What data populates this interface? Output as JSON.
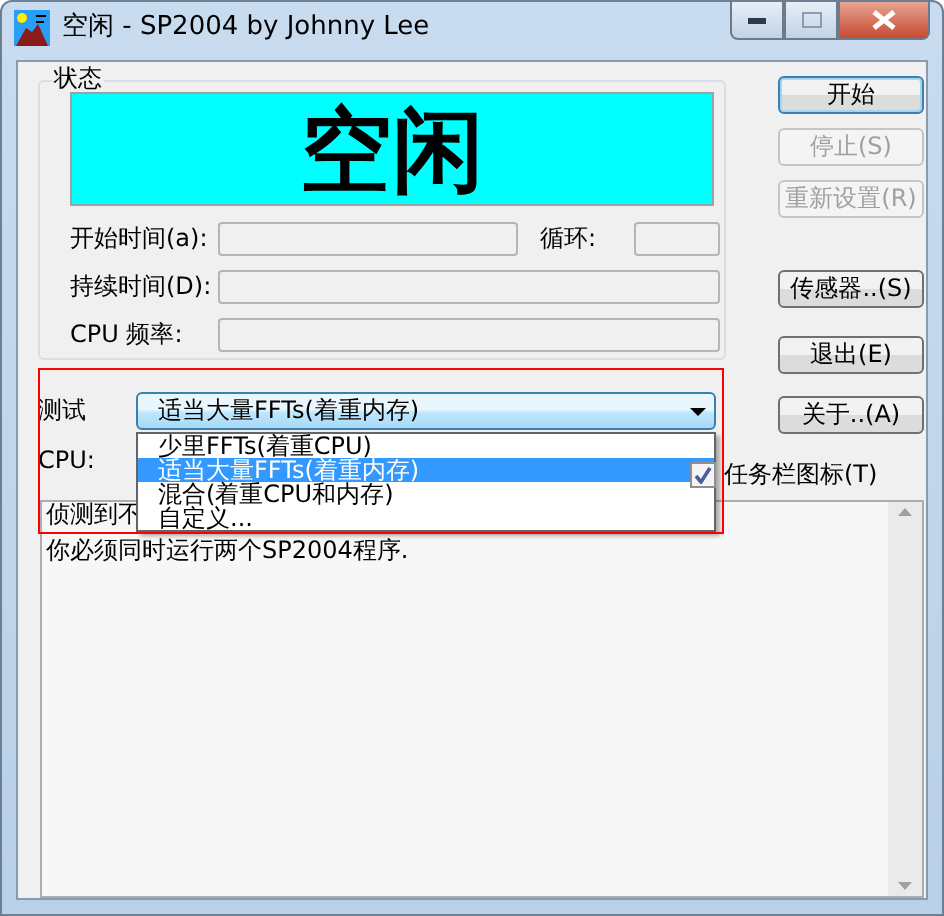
{
  "window": {
    "title": "空闲 - SP2004 by Johnny Lee"
  },
  "status": {
    "label": "状态",
    "display": "空闲",
    "start_time_label": "开始时间(a):",
    "loop_label": "循环:",
    "duration_label": "持续时间(D):",
    "cpu_freq_label": "CPU 频率:"
  },
  "buttons": [
    {
      "label": "开始",
      "disabled": false,
      "default": true
    },
    {
      "label": "停止(S)",
      "disabled": true,
      "default": false
    },
    {
      "label": "重新设置(R)",
      "disabled": true,
      "default": false
    },
    {
      "label": "传感器..(S)",
      "disabled": false,
      "default": false
    },
    {
      "label": "退出(E)",
      "disabled": false,
      "default": false
    },
    {
      "label": "关于..(A)",
      "disabled": false,
      "default": false
    }
  ],
  "test": {
    "label": "测试",
    "value": "适当大量FFTs(着重内存)",
    "expanded": true,
    "options": [
      {
        "label": "少里FFTs(着重CPU)",
        "selected": false
      },
      {
        "label": "适当大量FFTs(着重内存)",
        "selected": true
      },
      {
        "label": "混合(着重CPU和内存)",
        "selected": false
      },
      {
        "label": "自定义...",
        "selected": false
      }
    ]
  },
  "cpu_label": "CPU:",
  "taskbar_icon": {
    "label": "任务栏图标(T)",
    "checked": true
  },
  "log": {
    "lines": [
      "侦测到不",
      "你必须同时运行两个SP2004程序."
    ]
  }
}
